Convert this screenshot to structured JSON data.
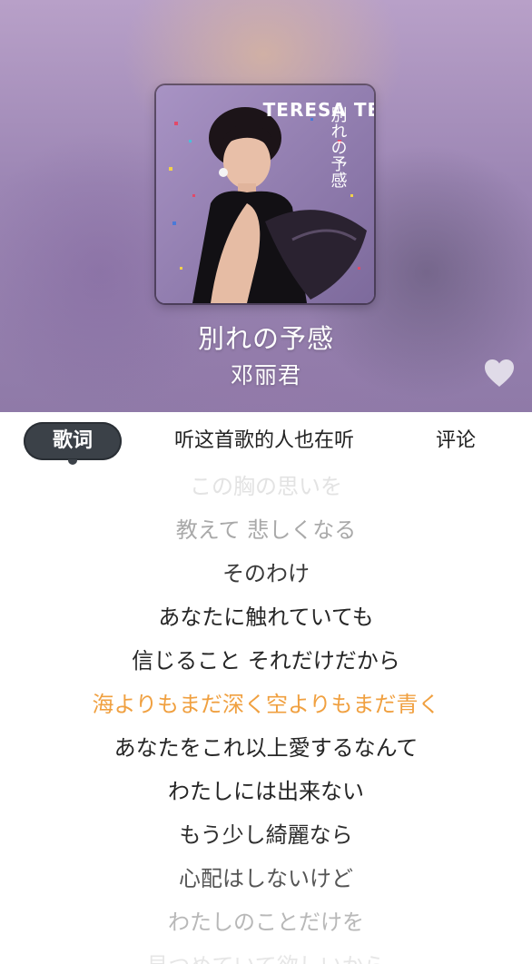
{
  "now_playing": {
    "title": "別れの予感",
    "artist": "邓丽君",
    "liked": false
  },
  "cover": {
    "artist_text": "TERESA TENG",
    "title_text": "別れの予感"
  },
  "tabs": {
    "active": "lyrics",
    "lyrics_label": "歌词",
    "listeners_label": "听这首歌的人也在听",
    "comments_label": "评论"
  },
  "lyrics": {
    "current_index": 5,
    "lines": [
      "この胸の思いを",
      "教えて 悲しくなる",
      "そのわけ",
      "あなたに触れていても",
      "信じること それだけだから",
      "海よりもまだ深く空よりもまだ青く",
      "あなたをこれ以上愛するなんて",
      "わたしには出来ない",
      "もう少し綺麗なら",
      "心配はしないけど",
      "わたしのことだけを",
      "見つめていて欲しいから"
    ]
  },
  "colors": {
    "accent_current_lyric": "#f0a040",
    "active_tab_bg": "#3b4148",
    "header_bg": "#9c86b4"
  },
  "icons": {
    "like": "heart-icon"
  }
}
